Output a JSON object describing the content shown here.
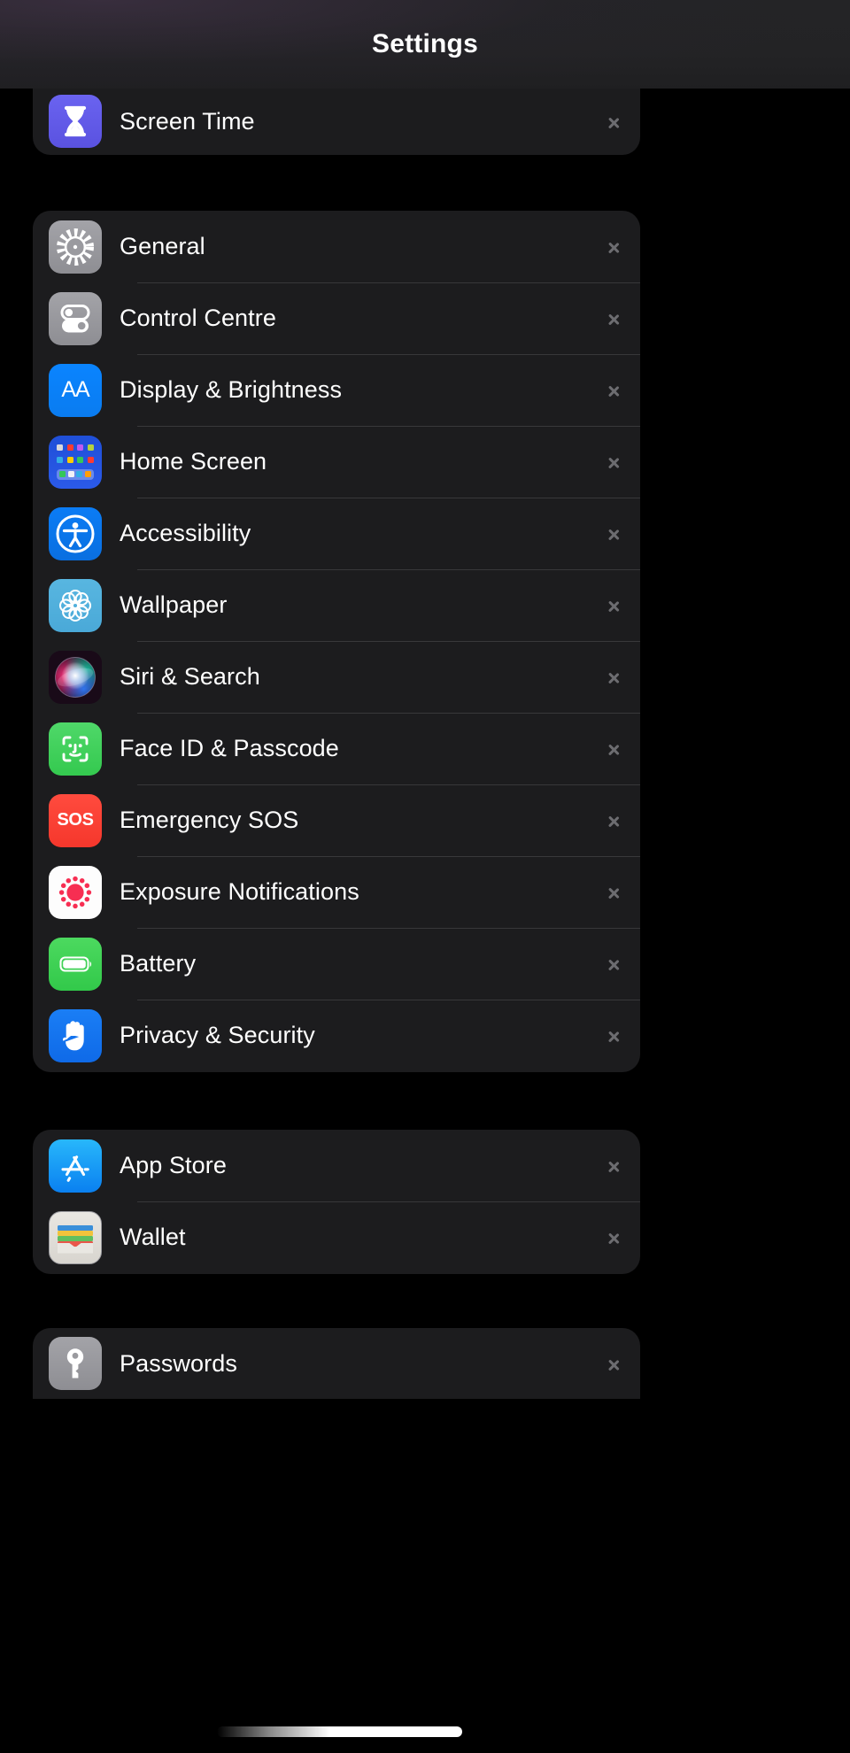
{
  "header": {
    "title": "Settings"
  },
  "colors": {
    "background": "#000000",
    "card": "#1c1c1e",
    "separator": "#38383a",
    "label": "#ffffff",
    "chevron": "#6c6c70",
    "nav_bar": "#232325"
  },
  "groups": [
    {
      "id": "group-screen-time",
      "clipped_top": true,
      "rows": [
        {
          "label": "Screen Time",
          "icon": "hourglass-icon",
          "icon_class": "ic-screentime",
          "chevron": true
        }
      ]
    },
    {
      "id": "group-system",
      "rows": [
        {
          "label": "General",
          "icon": "gear-icon",
          "icon_class": "ic-general",
          "chevron": true
        },
        {
          "label": "Control Centre",
          "icon": "toggle-switches-icon",
          "icon_class": "ic-control",
          "chevron": true
        },
        {
          "label": "Display & Brightness",
          "icon": "text-size-aa-icon",
          "icon_class": "ic-display",
          "chevron": true
        },
        {
          "label": "Home Screen",
          "icon": "app-grid-icon",
          "icon_class": "ic-home",
          "chevron": true
        },
        {
          "label": "Accessibility",
          "icon": "accessibility-person-icon",
          "icon_class": "ic-access",
          "chevron": true
        },
        {
          "label": "Wallpaper",
          "icon": "flower-rosette-icon",
          "icon_class": "ic-wallpaper",
          "chevron": true
        },
        {
          "label": "Siri & Search",
          "icon": "siri-orb-icon",
          "icon_class": "ic-siri",
          "chevron": true
        },
        {
          "label": "Face ID & Passcode",
          "icon": "face-id-icon",
          "icon_class": "ic-faceid",
          "chevron": true
        },
        {
          "label": "Emergency SOS",
          "icon": "sos-icon",
          "icon_class": "ic-sos",
          "chevron": true
        },
        {
          "label": "Exposure Notifications",
          "icon": "exposure-dots-icon",
          "icon_class": "ic-exposure",
          "chevron": true
        },
        {
          "label": "Battery",
          "icon": "battery-icon",
          "icon_class": "ic-battery",
          "chevron": true
        },
        {
          "label": "Privacy & Security",
          "icon": "raised-hand-icon",
          "icon_class": "ic-privacy",
          "chevron": true
        }
      ]
    },
    {
      "id": "group-store",
      "rows": [
        {
          "label": "App Store",
          "icon": "app-store-icon",
          "icon_class": "ic-appstore",
          "chevron": true
        },
        {
          "label": "Wallet",
          "icon": "wallet-icon",
          "icon_class": "ic-wallet",
          "chevron": true
        }
      ]
    },
    {
      "id": "group-passwords",
      "clipped_bottom": true,
      "rows": [
        {
          "label": "Passwords",
          "icon": "key-icon",
          "icon_class": "ic-passwords",
          "chevron": true
        }
      ]
    }
  ],
  "home_screen_icon": {
    "row1": [
      "#d8d8dd",
      "#ff3b30",
      "#bf5af2",
      "#b5d33d"
    ],
    "row2": [
      "#32ade6",
      "#ffcc00",
      "#34c759",
      "#ff3b30"
    ],
    "dock": [
      "#34c759",
      "#f2f2f7",
      "#32ade6",
      "#ff9f0a"
    ]
  },
  "wallet_icon": {
    "stripes": [
      "#3a8fd9",
      "#f0c33c",
      "#5fbf5f",
      "#e8564a"
    ]
  },
  "sos_icon": {
    "text": "SOS"
  },
  "display_icon": {
    "text": "AA"
  },
  "home_indicator": {
    "visible": true
  }
}
